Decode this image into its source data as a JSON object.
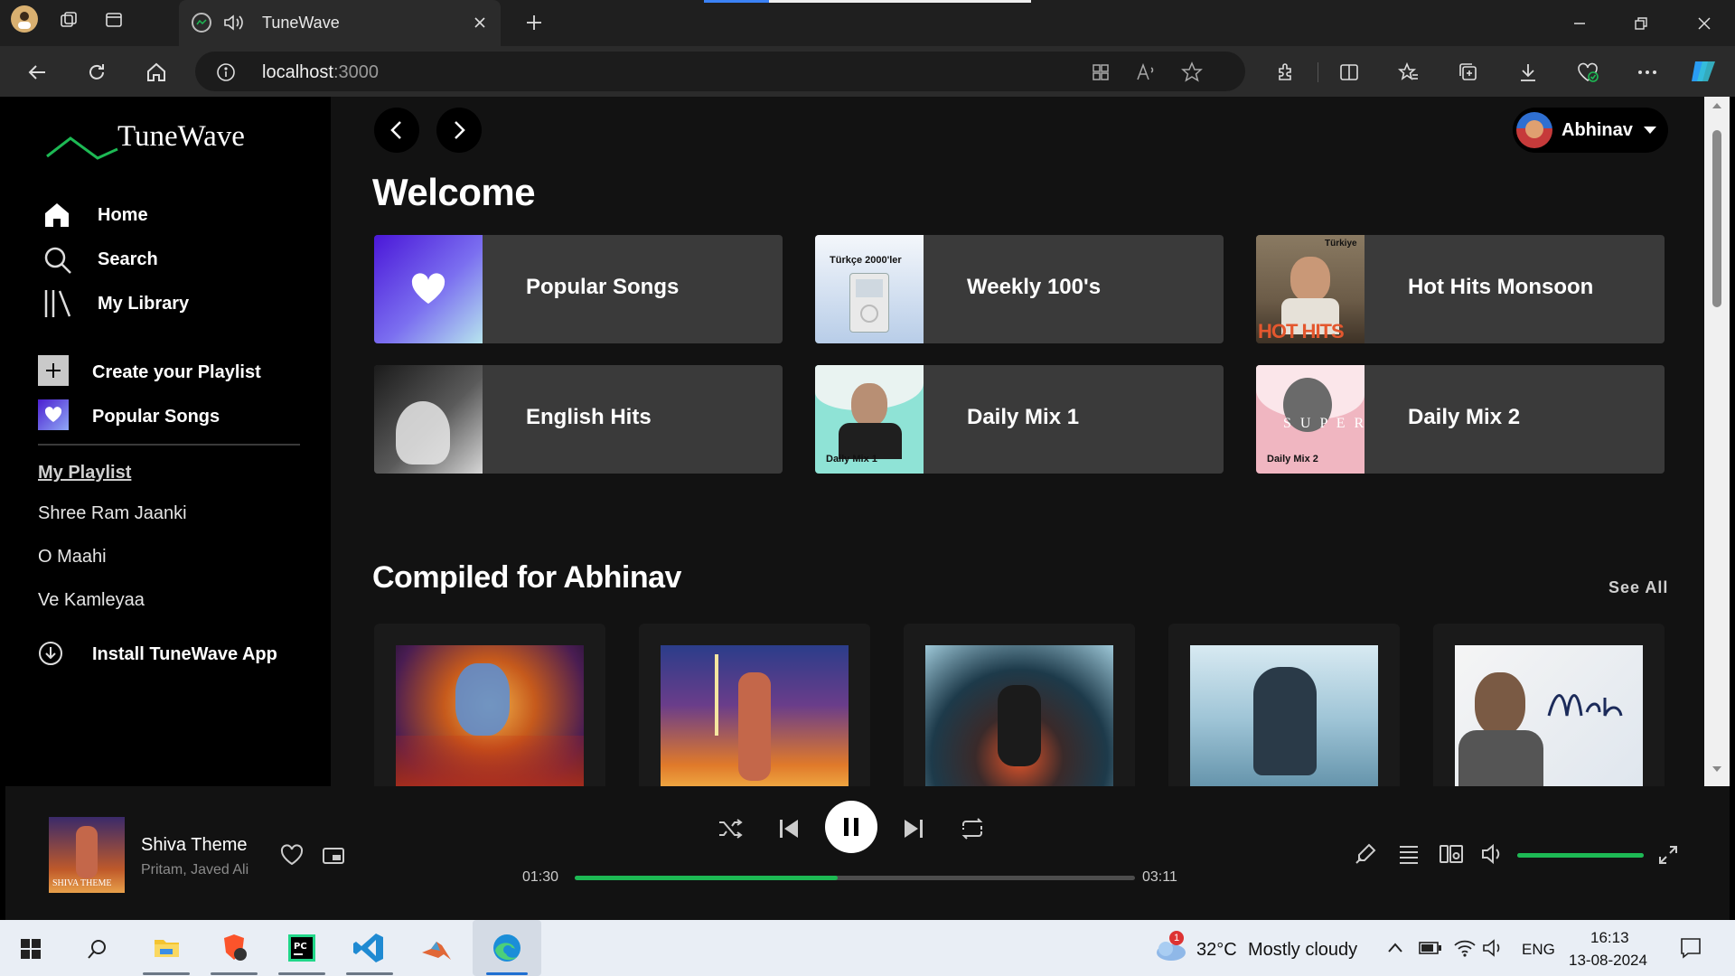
{
  "browser": {
    "tab_title": "TuneWave",
    "url_host": "localhost",
    "url_port": ":3000"
  },
  "app": {
    "logo_text": "TuneWave",
    "nav": {
      "home": "Home",
      "search": "Search",
      "library": "My Library"
    },
    "actions": {
      "create_playlist": "Create your Playlist",
      "popular_songs": "Popular Songs"
    },
    "my_playlist": {
      "heading": "My Playlist",
      "items": [
        "Shree Ram Jaanki",
        "O Maahi",
        "Ve Kamleyaa"
      ]
    },
    "install": "Install TuneWave App",
    "user": {
      "name": "Abhinav"
    },
    "welcome": "Welcome",
    "quick_cards": [
      {
        "label": "Popular Songs"
      },
      {
        "label": "Weekly 100's",
        "thumb_text": "Türkçe 2000'ler"
      },
      {
        "label": "Hot Hits Monsoon",
        "thumb_text": "Türkiye",
        "thumb_text2": "HOT HITS"
      },
      {
        "label": "English Hits"
      },
      {
        "label": "Daily Mix 1",
        "thumb_text": "Daily Mix 1"
      },
      {
        "label": "Daily Mix 2",
        "thumb_text": "Daily Mix 2",
        "thumb_text2": "S U P E R"
      }
    ],
    "compiled": {
      "heading": "Compiled for Abhinav",
      "see_all": "See All"
    }
  },
  "player": {
    "song": "Shiva Theme",
    "artist": "Pritam, Javed Ali",
    "thumb_text": "SHIVA THEME",
    "elapsed": "01:30",
    "duration": "03:11",
    "progress_fraction": 0.47,
    "volume_fraction": 1.0
  },
  "taskbar": {
    "temp": "32°C",
    "weather": "Mostly cloudy",
    "weather_badge": "1",
    "lang": "ENG",
    "time": "16:13",
    "date": "13-08-2024"
  },
  "colors": {
    "accent": "#1db954",
    "bg": "#121212",
    "card": "#3a3a3a"
  }
}
